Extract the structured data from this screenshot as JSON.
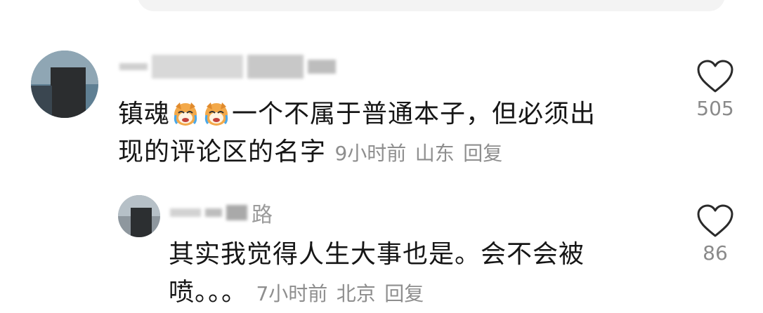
{
  "comments": [
    {
      "text_line1": "镇魂",
      "text_line1_rest": "一个不属于普通本子，但必须出",
      "text_line2": "现的评论区的名字",
      "time": "9小时前",
      "location": "山东",
      "reply_label": "回复",
      "likes": "505",
      "emoji_name": "crying-laughing-dog-emoji"
    },
    {
      "username_visible": "路",
      "text_line1": "其实我觉得人生大事也是。会不会被",
      "text_line2": "喷。。。",
      "time": "7小时前",
      "location": "北京",
      "reply_label": "回复",
      "likes": "86"
    }
  ],
  "colors": {
    "text": "#161616",
    "meta": "#8e8e8e",
    "icon": "#2a2a2a"
  }
}
